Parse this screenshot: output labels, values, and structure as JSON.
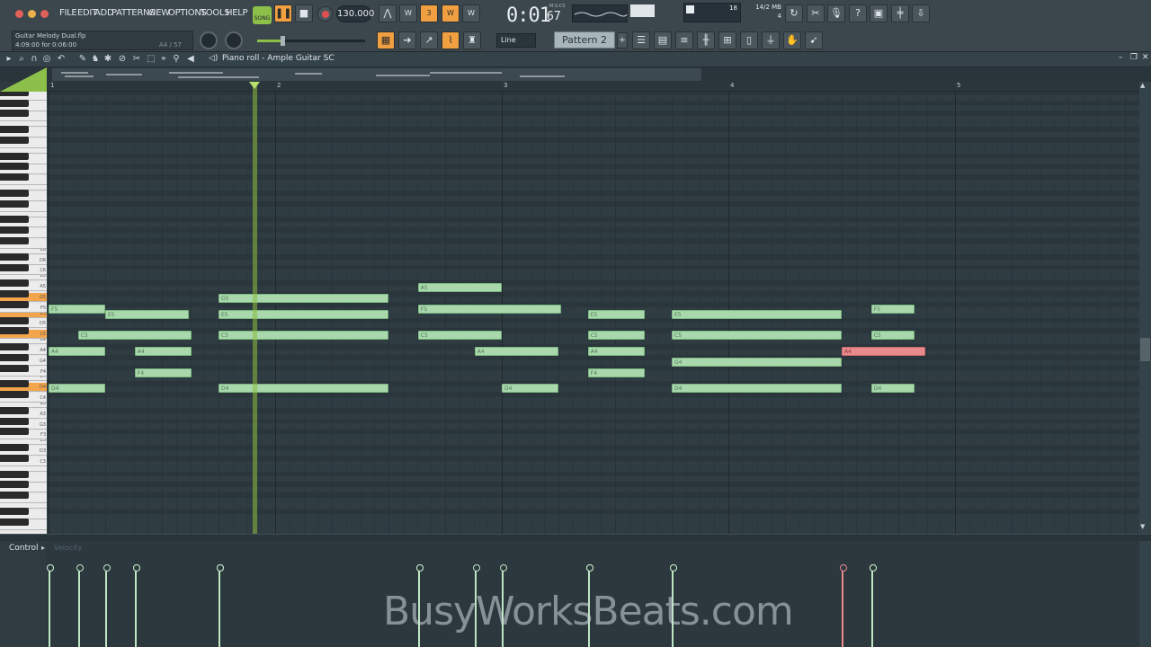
{
  "menu": [
    "FILE",
    "EDIT",
    "ADD",
    "PATTERNS",
    "VIEW",
    "OPTIONS",
    "TOOLS",
    "HELP"
  ],
  "transport": {
    "mode": "SONG",
    "tempo": "130.000",
    "time_main": "0:01",
    "time_sub": "67",
    "time_unit": "M:S:CS"
  },
  "project": {
    "file": "Guitar Melody Dual.flp",
    "info": "4:09:00 for 0:06:00",
    "note_info": "A4 / 57"
  },
  "system": {
    "memory": "14/2 MB",
    "cpu": "18",
    "poly": "4"
  },
  "snap": "Line",
  "pattern": "Pattern 2",
  "pianoroll_title": "Piano roll - Ample Guitar SC",
  "bars": [
    "1",
    "2",
    "3",
    "4",
    "5"
  ],
  "keys": [
    "E6",
    "D6",
    "C6",
    "B5",
    "A5",
    "G5",
    "F5",
    "E5",
    "D5",
    "C5",
    "B4",
    "A4",
    "G4",
    "F4",
    "E4",
    "D4",
    "C4",
    "B3",
    "A3",
    "G3",
    "F3",
    "E3",
    "D3",
    "C3"
  ],
  "highlighted_keys": [
    "G5",
    "E5",
    "C5",
    "D4"
  ],
  "notes": [
    {
      "pitch": "A5",
      "label": "A5",
      "start": 3.63,
      "len": 0.37
    },
    {
      "pitch": "G5",
      "label": "G5",
      "start": 2.75,
      "len": 0.75
    },
    {
      "pitch": "F5",
      "label": "F5",
      "start": 2.0,
      "len": 0.25
    },
    {
      "pitch": "F5",
      "label": "F5",
      "start": 3.63,
      "len": 0.63
    },
    {
      "pitch": "F5",
      "label": "F5",
      "start": 5.63,
      "len": 0.19
    },
    {
      "pitch": "E5",
      "label": "E5",
      "start": 2.25,
      "len": 0.37
    },
    {
      "pitch": "E5",
      "label": "E5",
      "start": 2.75,
      "len": 0.75
    },
    {
      "pitch": "E5",
      "label": "E5",
      "start": 4.38,
      "len": 0.25
    },
    {
      "pitch": "E5",
      "label": "E5",
      "start": 4.75,
      "len": 0.75
    },
    {
      "pitch": "C5",
      "label": "C5",
      "start": 2.13,
      "len": 0.5
    },
    {
      "pitch": "C5",
      "label": "C5",
      "start": 2.75,
      "len": 0.75
    },
    {
      "pitch": "C5",
      "label": "C5",
      "start": 3.63,
      "len": 0.37
    },
    {
      "pitch": "C5",
      "label": "C5",
      "start": 4.38,
      "len": 0.25
    },
    {
      "pitch": "C5",
      "label": "C5",
      "start": 4.75,
      "len": 0.75
    },
    {
      "pitch": "C5",
      "label": "C5",
      "start": 5.63,
      "len": 0.19
    },
    {
      "pitch": "A4",
      "label": "A4",
      "start": 2.0,
      "len": 0.25
    },
    {
      "pitch": "A4",
      "label": "A4",
      "start": 2.38,
      "len": 0.25
    },
    {
      "pitch": "A4",
      "label": "A4",
      "start": 3.88,
      "len": 0.37
    },
    {
      "pitch": "A4",
      "label": "A4",
      "start": 4.38,
      "len": 0.25
    },
    {
      "pitch": "A4",
      "label": "A4",
      "start": 5.5,
      "len": 0.37,
      "selected": true
    },
    {
      "pitch": "G4",
      "label": "G4",
      "start": 4.75,
      "len": 0.75
    },
    {
      "pitch": "F4",
      "label": "F4",
      "start": 2.38,
      "len": 0.25
    },
    {
      "pitch": "F4",
      "label": "F4",
      "start": 4.38,
      "len": 0.25
    },
    {
      "pitch": "D4",
      "label": "D4",
      "start": 2.0,
      "len": 0.25
    },
    {
      "pitch": "D4",
      "label": "D4",
      "start": 2.75,
      "len": 0.75
    },
    {
      "pitch": "D4",
      "label": "D4",
      "start": 4.0,
      "len": 0.25
    },
    {
      "pitch": "D4",
      "label": "D4",
      "start": 4.75,
      "len": 0.75
    },
    {
      "pitch": "D4",
      "label": "D4",
      "start": 5.63,
      "len": 0.19
    }
  ],
  "playhead_beat": 2.9,
  "control": {
    "label": "Control",
    "param": "Velocity"
  },
  "watermark": "BusyWorksBeats.com"
}
